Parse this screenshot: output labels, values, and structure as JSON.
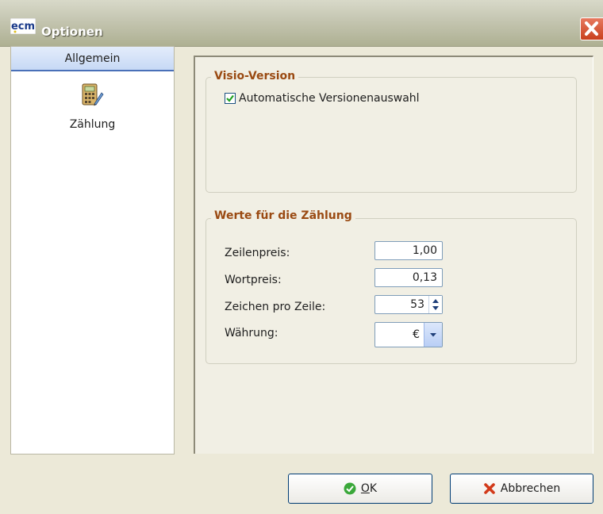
{
  "window": {
    "title": "Optionen",
    "logo_text": "ecm"
  },
  "sidebar": {
    "header": "Allgemein",
    "items": [
      {
        "label": "Zählung",
        "icon": "calculator-pen-icon"
      }
    ]
  },
  "visio_group": {
    "title": "Visio-Version",
    "auto_select_label": "Automatische Versionenauswahl",
    "auto_select_checked": true
  },
  "counting_group": {
    "title": "Werte für die Zählung",
    "fields": {
      "line_price": {
        "label": "Zeilenpreis:",
        "value": "1,00"
      },
      "word_price": {
        "label": "Wortpreis:",
        "value": "0,13"
      },
      "chars_per_line": {
        "label": "Zeichen pro Zeile:",
        "value": "53"
      },
      "currency": {
        "label": "Währung:",
        "value": "€"
      }
    }
  },
  "buttons": {
    "ok_prefix": "",
    "ok_underlined": "O",
    "ok_rest": "K",
    "cancel": "Abbrechen"
  },
  "colors": {
    "accent_blue": "#4a70b8",
    "group_title": "#9a4a12",
    "close_red": "#c9401d"
  }
}
